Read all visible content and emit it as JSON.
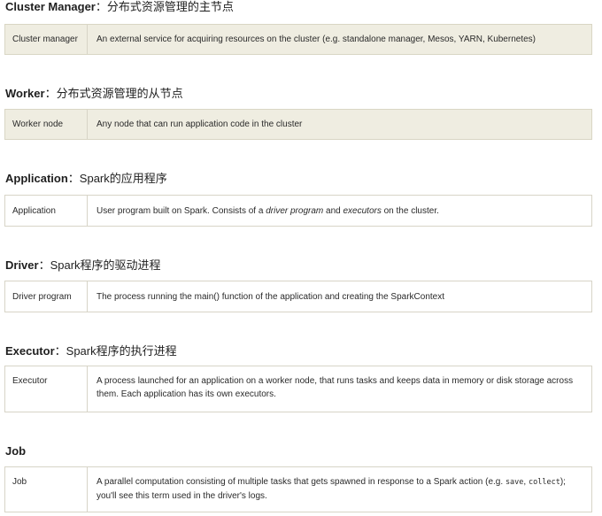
{
  "sections": [
    {
      "term": "Cluster Manager",
      "sep": "：",
      "desc": "分布式资源管理的主节点",
      "row_label": "Cluster manager",
      "row_text": "An external service for acquiring resources on the cluster (e.g. standalone manager, Mesos, YARN, Kubernetes)"
    },
    {
      "term": "Worker",
      "sep": "：",
      "desc": "分布式资源管理的从节点",
      "row_label": "Worker node",
      "row_text": "Any node that can run application code in the cluster"
    },
    {
      "term": "Application",
      "sep": "：",
      "desc": "Spark的应用程序",
      "row_label": "Application",
      "row_parts": [
        "User program built on Spark. Consists of a ",
        "driver program",
        " and ",
        "executors",
        " on the cluster."
      ]
    },
    {
      "term": "Driver",
      "sep": "：",
      "desc": "Spark程序的驱动进程",
      "row_label": "Driver program",
      "row_text": "The process running the main() function of the application and creating the SparkContext"
    },
    {
      "term": "Executor",
      "sep": "：",
      "desc": "Spark程序的执行进程",
      "row_label": "Executor",
      "row_text": "A process launched for an application on a worker node, that runs tasks and keeps data in memory or disk storage across them. Each application has its own executors."
    },
    {
      "term": "Job",
      "sep": "",
      "desc": "",
      "row_label": "Job",
      "row_parts": [
        "A parallel computation consisting of multiple tasks that gets spawned in response to a Spark action (e.g. ",
        "save",
        ", ",
        "collect",
        "); you'll see this term used in the driver's logs."
      ]
    }
  ]
}
